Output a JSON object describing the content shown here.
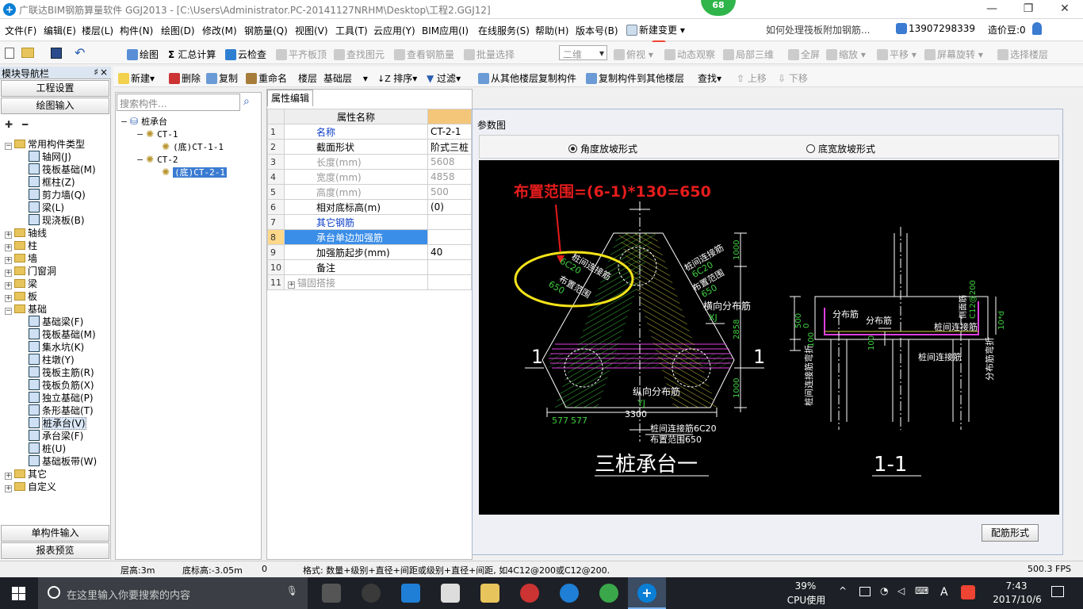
{
  "window": {
    "title": "广联达BIM钢筋算量软件 GGJ2013 - [C:\\Users\\Administrator.PC-20141127NRHM\\Desktop\\工程2.GGJ12]",
    "badge": "68"
  },
  "menu": [
    "文件(F)",
    "编辑(E)",
    "楼层(L)",
    "构件(N)",
    "绘图(D)",
    "修改(M)",
    "钢筋量(Q)",
    "视图(V)",
    "工具(T)",
    "云应用(Y)",
    "BIM应用(I)",
    "在线服务(S)",
    "帮助(H)",
    "版本号(B)"
  ],
  "menu_right": {
    "new_change": "新建变更",
    "news": "如何处理筏板附加钢筋...",
    "phone": "13907298339",
    "price": "造价豆:0"
  },
  "toolbar1": {
    "draw": "绘图",
    "sum": "汇总计算",
    "cloud_check": "云检查",
    "align_top": "平齐板顶",
    "find_elem": "查找图元",
    "view_rebar": "查看钢筋量",
    "batch_select": "批量选择",
    "view_mode": "二维",
    "top_view": "俯视",
    "dynamic": "动态观察",
    "local3d": "局部三维",
    "fullscreen": "全屏",
    "zoom": "缩放",
    "pan": "平移",
    "rotate": "屏幕旋转",
    "select_floor": "选择楼层"
  },
  "toolbar2": {
    "new": "新建",
    "delete": "删除",
    "copy": "复制",
    "rename": "重命名",
    "floor_label": "楼层",
    "floor": "基础层",
    "sort": "排序",
    "filter": "过滤",
    "copy_from": "从其他楼层复制构件",
    "copy_to": "复制构件到其他楼层",
    "find": "查找",
    "up": "上移",
    "down": "下移"
  },
  "nav": {
    "title": "模块导航栏",
    "pin": "♯",
    "close": "×",
    "project": "工程设置",
    "draw_input": "绘图输入",
    "single_input": "单构件输入",
    "report": "报表预览",
    "tree": [
      {
        "l": "常用构件类型",
        "d": 0,
        "exp": "−",
        "type": "folder"
      },
      {
        "l": "轴网(J)",
        "d": 1,
        "type": "comp"
      },
      {
        "l": "筏板基础(M)",
        "d": 1,
        "type": "comp"
      },
      {
        "l": "框柱(Z)",
        "d": 1,
        "type": "comp"
      },
      {
        "l": "剪力墙(Q)",
        "d": 1,
        "type": "comp"
      },
      {
        "l": "梁(L)",
        "d": 1,
        "type": "comp"
      },
      {
        "l": "现浇板(B)",
        "d": 1,
        "type": "comp"
      },
      {
        "l": "轴线",
        "d": 0,
        "exp": "+",
        "type": "folder"
      },
      {
        "l": "柱",
        "d": 0,
        "exp": "+",
        "type": "folder"
      },
      {
        "l": "墙",
        "d": 0,
        "exp": "+",
        "type": "folder"
      },
      {
        "l": "门窗洞",
        "d": 0,
        "exp": "+",
        "type": "folder"
      },
      {
        "l": "梁",
        "d": 0,
        "exp": "+",
        "type": "folder"
      },
      {
        "l": "板",
        "d": 0,
        "exp": "+",
        "type": "folder"
      },
      {
        "l": "基础",
        "d": 0,
        "exp": "−",
        "type": "folder"
      },
      {
        "l": "基础梁(F)",
        "d": 1,
        "type": "comp"
      },
      {
        "l": "筏板基础(M)",
        "d": 1,
        "type": "comp"
      },
      {
        "l": "集水坑(K)",
        "d": 1,
        "type": "comp"
      },
      {
        "l": "柱墩(Y)",
        "d": 1,
        "type": "comp"
      },
      {
        "l": "筏板主筋(R)",
        "d": 1,
        "type": "comp"
      },
      {
        "l": "筏板负筋(X)",
        "d": 1,
        "type": "comp"
      },
      {
        "l": "独立基础(P)",
        "d": 1,
        "type": "comp"
      },
      {
        "l": "条形基础(T)",
        "d": 1,
        "type": "comp"
      },
      {
        "l": "桩承台(V)",
        "d": 1,
        "type": "comp",
        "sel": true
      },
      {
        "l": "承台梁(F)",
        "d": 1,
        "type": "comp"
      },
      {
        "l": "桩(U)",
        "d": 1,
        "type": "comp"
      },
      {
        "l": "基础板带(W)",
        "d": 1,
        "type": "comp"
      },
      {
        "l": "其它",
        "d": 0,
        "exp": "+",
        "type": "folder"
      },
      {
        "l": "自定义",
        "d": 0,
        "exp": "+",
        "type": "folder"
      }
    ]
  },
  "components": {
    "search_placeholder": "搜索构件...",
    "tree": [
      {
        "l": "桩承台",
        "d": 0,
        "exp": "−"
      },
      {
        "l": "CT-1",
        "d": 1,
        "exp": "−"
      },
      {
        "l": "(底)CT-1-1",
        "d": 2
      },
      {
        "l": "CT-2",
        "d": 1,
        "exp": "−"
      },
      {
        "l": "(底)CT-2-1",
        "d": 2,
        "sel": true
      }
    ]
  },
  "props": {
    "tab": "属性编辑",
    "header": "属性名称",
    "rows": [
      {
        "n": "1",
        "k": "名称",
        "v": "CT-2-1",
        "s": "blue"
      },
      {
        "n": "2",
        "k": "截面形状",
        "v": "阶式三桩",
        "s": ""
      },
      {
        "n": "3",
        "k": "长度(mm)",
        "v": "5608",
        "s": "gray"
      },
      {
        "n": "4",
        "k": "宽度(mm)",
        "v": "4858",
        "s": "gray"
      },
      {
        "n": "5",
        "k": "高度(mm)",
        "v": "500",
        "s": "gray"
      },
      {
        "n": "6",
        "k": "相对底标高(m)",
        "v": "(0)",
        "s": ""
      },
      {
        "n": "7",
        "k": "其它钢筋",
        "v": "",
        "s": "blue"
      },
      {
        "n": "8",
        "k": "承台单边加强筋",
        "v": "",
        "s": "sel"
      },
      {
        "n": "9",
        "k": "加强筋起步(mm)",
        "v": "40",
        "s": ""
      },
      {
        "n": "10",
        "k": "备注",
        "v": "",
        "s": ""
      },
      {
        "n": "11",
        "k": "锚固搭接",
        "v": "",
        "s": "gray",
        "plus": true
      }
    ]
  },
  "dialog": {
    "title": "参数图",
    "radio1": "角度放坡形式",
    "radio2": "底宽放坡形式",
    "button": "配筋形式"
  },
  "drawing": {
    "annotation": "布置范围=(6-1)*130=650",
    "plan_title": "三桩承台一",
    "section_title": "1-1",
    "sec_mark": "1",
    "l_lianjie": "桩间连接筋",
    "l_6c20": "6C20",
    "l_buzhi": "布置范围",
    "l_650": "650",
    "l_hengxiang": "横向分布筋",
    "l_xj": "XJ",
    "l_zongxiang": "纵向分布筋",
    "l_yj": "YJ",
    "d_1000a": "1000",
    "d_2858": "2858",
    "d_1000b": "1000",
    "d_3300": "3300",
    "d_577": "577",
    "l_lianjie_b": "桩间连接筋6C20",
    "l_buzhi_b": "布置范围650",
    "s_fenbu1": "分布筋",
    "s_fenbu2": "分布筋",
    "s_lianjie": "桩间连接筋",
    "s_lianjie2": "桩间连接筋",
    "s_500": "500",
    "s_0": "0",
    "s_100": "100",
    "s_ce": "侧面筋",
    "s_c12": "C12@200",
    "s_10d": "10*d",
    "s_wanzhe_l": "桩间连接筋弯折",
    "s_wanzhe_r": "分布筋弯折"
  },
  "status": {
    "floor_h": "层高:3m",
    "bottom": "底标高:-3.05m",
    "zero": "0",
    "format": "格式: 数量+级别+直径+间距或级别+直径+间距, 如4C12@200或C12@200.",
    "fps": "500.3 FPS"
  },
  "taskbar": {
    "search": "在这里输入你要搜索的内容",
    "cpu_pct": "39%",
    "cpu_label": "CPU使用",
    "ime": "A",
    "time": "7:43",
    "date": "2017/10/6"
  }
}
